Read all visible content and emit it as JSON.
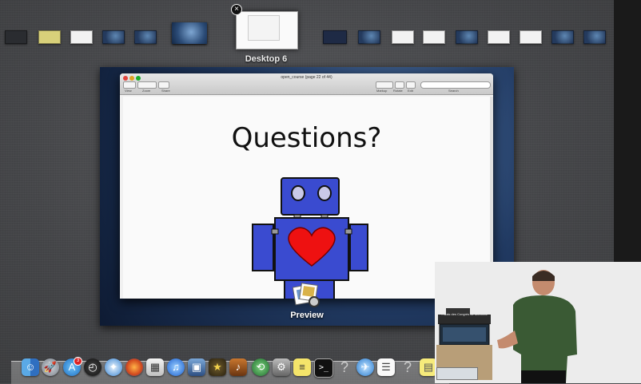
{
  "mission_control": {
    "current_desktop_label": "Desktop 6",
    "close_symbol": "×"
  },
  "preview_window": {
    "title": "open_course (page 22 of 44)",
    "toolbar": {
      "view_label": "View",
      "zoom_label": "Zoom",
      "share_label": "Share",
      "markup_label": "Markup",
      "rotate_label": "Rotate",
      "edit_label": "Edit",
      "search_label": "Search"
    },
    "slide_title": "Questions?"
  },
  "app_label": "Preview",
  "dock": {
    "mail_badge": "3",
    "items": [
      "finder-icon",
      "launchpad-icon",
      "app-store-icon",
      "dashboard-icon",
      "safari-icon",
      "firefox-icon",
      "preview-icon",
      "itunes-icon",
      "iphoto-icon",
      "imovie-icon",
      "garageband-icon",
      "time-machine-icon",
      "system-preferences-icon",
      "stickies-icon",
      "terminal-icon",
      "unknown-app-icon",
      "network-icon",
      "textedit-icon",
      "unknown-app-icon",
      "notes-icon"
    ]
  },
  "video_overlay": {
    "podium_sign": "Palais des Congrès de Montréal"
  }
}
